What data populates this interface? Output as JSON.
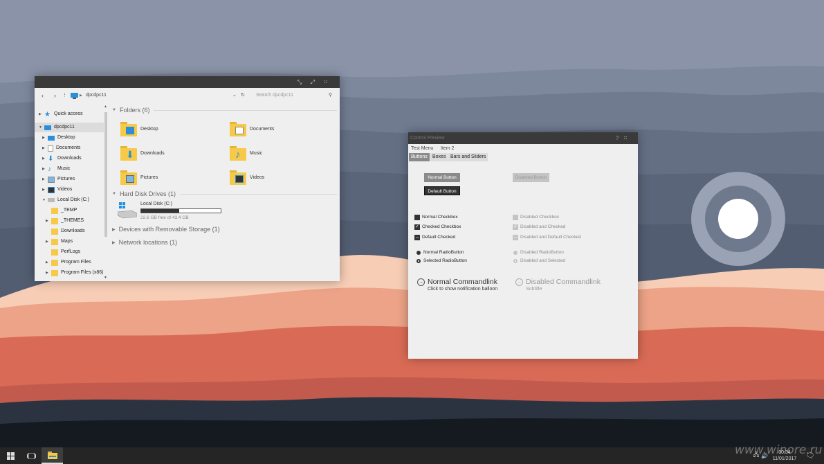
{
  "explorer": {
    "address": "dpcdpc11",
    "search_placeholder": "Search dpcdpc11",
    "tree": [
      {
        "label": "Quick access"
      },
      {
        "label": "dpcdpc11"
      },
      {
        "label": "Desktop"
      },
      {
        "label": "Documents"
      },
      {
        "label": "Downloads"
      },
      {
        "label": "Music"
      },
      {
        "label": "Pictures"
      },
      {
        "label": "Videos"
      },
      {
        "label": "Local Disk (C:)"
      },
      {
        "label": "_TEMP"
      },
      {
        "label": "_THEMES"
      },
      {
        "label": "Downloads"
      },
      {
        "label": "Maps"
      },
      {
        "label": "PerfLogs"
      },
      {
        "label": "Program Files"
      },
      {
        "label": "Program Files (x86)"
      }
    ],
    "groups": {
      "folders": "Folders (6)",
      "drives": "Hard Disk Drives (1)",
      "removable": "Devices with Removable Storage (1)",
      "network": "Network locations (1)"
    },
    "folders": [
      "Desktop",
      "Documents",
      "Downloads",
      "Music",
      "Pictures",
      "Videos"
    ],
    "drive": {
      "name": "Local Disk (C:)",
      "free": "22.6 GB free of 43.4 GB",
      "used_fraction": 0.48
    }
  },
  "control": {
    "title": "Control Preview",
    "menu": [
      "Test Menu",
      "Item 2"
    ],
    "tabs": [
      "Buttons",
      "Boxes",
      "Bars and Sliders"
    ],
    "buttons": {
      "normal": "Normal Button",
      "default": "Default Button",
      "disabled": "Disabled Button"
    },
    "checkboxes": {
      "normal": "Normal Checkbox",
      "checked": "Checked Checkbox",
      "default_checked": "Default Checked",
      "disabled": "Disabled Checkbox",
      "disabled_checked": "Disabled and Checked",
      "disabled_default": "Disabled and Default Checked"
    },
    "radios": {
      "normal": "Normal RadioButton",
      "selected": "Selected RadioButton",
      "disabled": "Disabled RadioButton",
      "disabled_selected": "Disabled and Selected"
    },
    "commandlinks": {
      "normal_main": "Normal Commandlink",
      "normal_sub": "Click to show notification balloon",
      "disabled_main": "Disabled Commandlink",
      "disabled_sub": "Subtitle"
    }
  },
  "taskbar": {
    "time": "00:34",
    "date": "11/01/2017"
  },
  "watermark": "www.winore.ru",
  "colors": {
    "titlebar": "#3a3a3a",
    "window_bg": "#efefef",
    "taskbar": "#252525",
    "folder": "#f7c948",
    "accent_blue": "#1e90e0"
  }
}
